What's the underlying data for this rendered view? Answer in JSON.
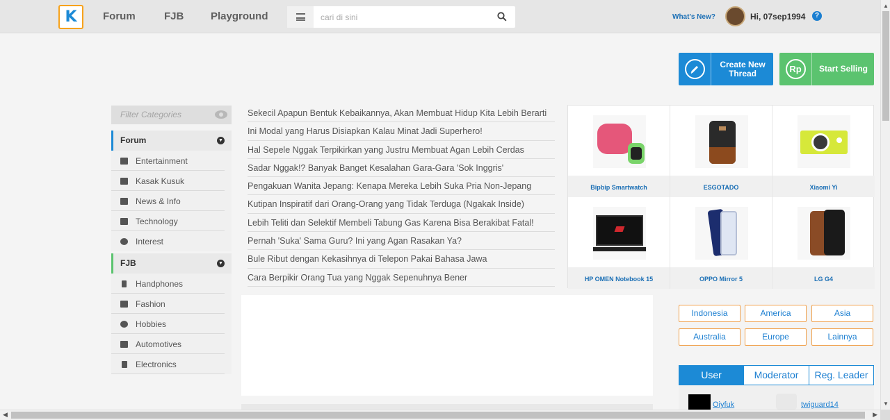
{
  "header": {
    "logo_letter": "K",
    "nav": [
      "Forum",
      "FJB",
      "Playground"
    ],
    "search_placeholder": "cari di sini",
    "whats_new": "What's New?",
    "greeting": "Hi, 07sep1994",
    "help_symbol": "?"
  },
  "actions": {
    "create_thread": "Create New Thread",
    "create_icon": "pencil-icon",
    "start_selling": "Start Selling",
    "sell_icon_text": "Rp"
  },
  "sidebar": {
    "filter_placeholder": "Filter Categories",
    "forum": {
      "title": "Forum",
      "items": [
        "Entertainment",
        "Kasak Kusuk",
        "News & Info",
        "Technology",
        "Interest"
      ]
    },
    "fjb": {
      "title": "FJB",
      "items": [
        "Handphones",
        "Fashion",
        "Hobbies",
        "Automotives",
        "Electronics"
      ]
    }
  },
  "threads": [
    "Sekecil Apapun Bentuk Kebaikannya, Akan Membuat Hidup Kita Lebih Berarti",
    "Ini Modal yang Harus Disiapkan Kalau Minat Jadi Superhero!",
    "Hal Sepele Nggak Terpikirkan yang Justru Membuat Agan Lebih Cerdas",
    "Sadar Nggak!? Banyak Banget Kesalahan Gara-Gara 'Sok Inggris'",
    "Pengakuan Wanita Jepang: Kenapa Mereka Lebih Suka Pria Non-Jepang",
    "Kutipan Inspiratif dari Orang-Orang yang Tidak Terduga (Ngakak Inside)",
    "Lebih Teliti dan Selektif Membeli Tabung Gas Karena Bisa Berakibat Fatal!",
    "Pernah 'Suka' Sama Guru? Ini yang Agan Rasakan Ya?",
    "Bule Ribut dengan Kekasihnya di Telepon Pakai Bahasa Jawa",
    "Cara Berpikir Orang Tua yang Nggak Sepenuhnya Bener"
  ],
  "products": [
    "Bipbip Smartwatch",
    "ESGOTADO",
    "Xiaomi Yi",
    "HP OMEN Notebook 15",
    "OPPO Mirror 5",
    "LG G4"
  ],
  "regions": [
    "Indonesia",
    "America",
    "Asia",
    "Australia",
    "Europe",
    "Lainnya"
  ],
  "tabs": [
    "User",
    "Moderator",
    "Reg. Leader"
  ],
  "users": [
    "Oiyfuk",
    "twiguard14"
  ],
  "colors": {
    "primary": "#1c8ad6",
    "sell": "#5bc36f",
    "logo_border": "#f7a21b",
    "region_border": "#f0a04b"
  }
}
